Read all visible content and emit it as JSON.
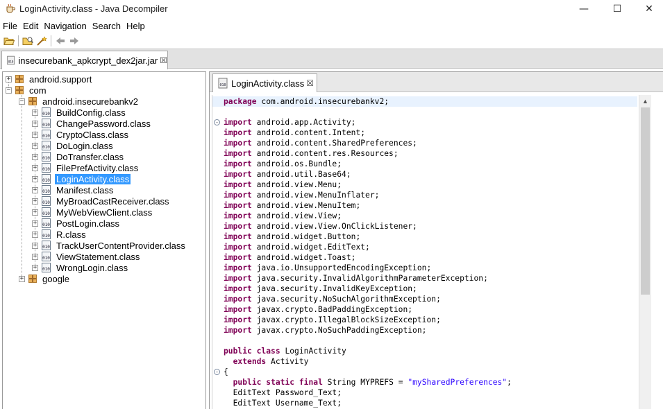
{
  "window": {
    "title": "LoginActivity.class - Java Decompiler",
    "minimize": "—",
    "maximize": "☐",
    "close": "✕"
  },
  "menu": [
    "File",
    "Edit",
    "Navigation",
    "Search",
    "Help"
  ],
  "toolbar": {
    "icons": [
      "open-folder-icon",
      "open-type-icon",
      "wand-icon",
      "back-icon",
      "forward-icon"
    ]
  },
  "top_tab": {
    "label": "insecurebank_apkcrypt_dex2jar.jar",
    "close": "☒"
  },
  "tree": {
    "nodes": [
      {
        "label": "android.support",
        "kind": "package",
        "expander": "+"
      },
      {
        "label": "com",
        "kind": "package",
        "expander": "−"
      },
      {
        "label": "android.insecurebankv2",
        "kind": "package",
        "expander": "−"
      },
      {
        "label": "BuildConfig.class",
        "kind": "class",
        "expander": "+"
      },
      {
        "label": "ChangePassword.class",
        "kind": "class",
        "expander": "+"
      },
      {
        "label": "CryptoClass.class",
        "kind": "class",
        "expander": "+"
      },
      {
        "label": "DoLogin.class",
        "kind": "class",
        "expander": "+"
      },
      {
        "label": "DoTransfer.class",
        "kind": "class",
        "expander": "+"
      },
      {
        "label": "FilePrefActivity.class",
        "kind": "class",
        "expander": "+"
      },
      {
        "label": "LoginActivity.class",
        "kind": "class",
        "expander": "+",
        "selected": true
      },
      {
        "label": "Manifest.class",
        "kind": "class",
        "expander": "+"
      },
      {
        "label": "MyBroadCastReceiver.class",
        "kind": "class",
        "expander": "+"
      },
      {
        "label": "MyWebViewClient.class",
        "kind": "class",
        "expander": "+"
      },
      {
        "label": "PostLogin.class",
        "kind": "class",
        "expander": "+"
      },
      {
        "label": "R.class",
        "kind": "class",
        "expander": "+"
      },
      {
        "label": "TrackUserContentProvider.class",
        "kind": "class",
        "expander": "+"
      },
      {
        "label": "ViewStatement.class",
        "kind": "class",
        "expander": "+"
      },
      {
        "label": "WrongLogin.class",
        "kind": "class",
        "expander": "+"
      },
      {
        "label": "google",
        "kind": "package",
        "expander": "+"
      }
    ]
  },
  "editor": {
    "tab_label": "LoginActivity.class",
    "tab_close": "☒",
    "class_icon_text": "010",
    "lines": [
      {
        "text": "package com.android.insecurebankv2;",
        "hl": true
      },
      {
        "text": ""
      },
      {
        "text": "import android.app.Activity;",
        "fold": "⊖"
      },
      {
        "text": "import android.content.Intent;"
      },
      {
        "text": "import android.content.SharedPreferences;"
      },
      {
        "text": "import android.content.res.Resources;"
      },
      {
        "text": "import android.os.Bundle;"
      },
      {
        "text": "import android.util.Base64;"
      },
      {
        "text": "import android.view.Menu;"
      },
      {
        "text": "import android.view.MenuInflater;"
      },
      {
        "text": "import android.view.MenuItem;"
      },
      {
        "text": "import android.view.View;"
      },
      {
        "text": "import android.view.View.OnClickListener;"
      },
      {
        "text": "import android.widget.Button;"
      },
      {
        "text": "import android.widget.EditText;"
      },
      {
        "text": "import android.widget.Toast;"
      },
      {
        "text": "import java.io.UnsupportedEncodingException;"
      },
      {
        "text": "import java.security.InvalidAlgorithmParameterException;"
      },
      {
        "text": "import java.security.InvalidKeyException;"
      },
      {
        "text": "import java.security.NoSuchAlgorithmException;"
      },
      {
        "text": "import javax.crypto.BadPaddingException;"
      },
      {
        "text": "import javax.crypto.IllegalBlockSizeException;"
      },
      {
        "text": "import javax.crypto.NoSuchPaddingException;"
      },
      {
        "text": ""
      },
      {
        "text": "public class LoginActivity"
      },
      {
        "text": "  extends Activity"
      },
      {
        "text": "{",
        "fold": "⊖"
      },
      {
        "text": "  public static final String MYPREFS = \"mySharedPreferences\";"
      },
      {
        "text": "  EditText Password_Text;"
      },
      {
        "text": "  EditText Username_Text;"
      }
    ]
  },
  "scrollbar": {
    "up_arrow": "▲"
  },
  "keywords": [
    "package",
    "import",
    "public",
    "class",
    "extends",
    "static",
    "final"
  ]
}
